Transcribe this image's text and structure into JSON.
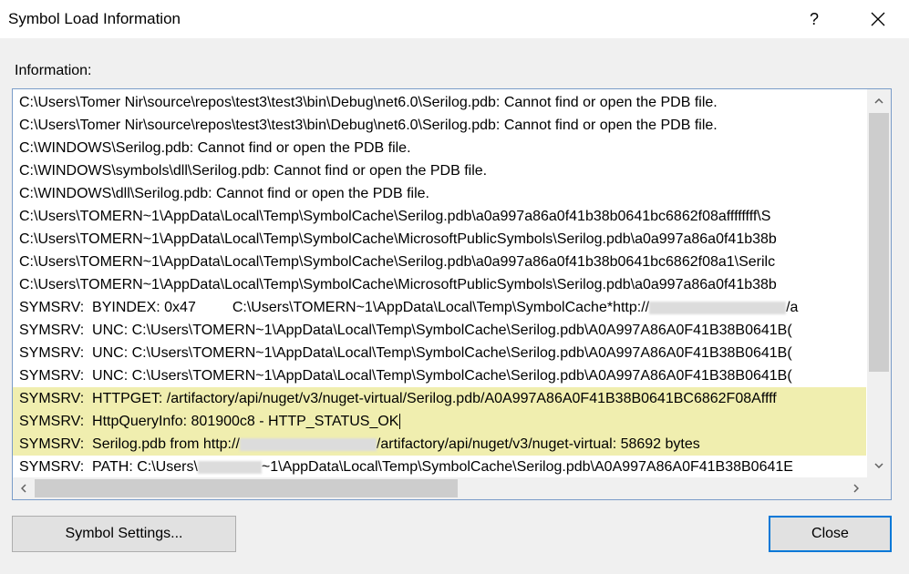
{
  "window": {
    "title": "Symbol Load Information",
    "help_label": "?"
  },
  "info_label": "Information:",
  "lines": [
    "C:\\Users\\Tomer Nir\\source\\repos\\test3\\test3\\bin\\Debug\\net6.0\\Serilog.pdb: Cannot find or open the PDB file.",
    "C:\\Users\\Tomer Nir\\source\\repos\\test3\\test3\\bin\\Debug\\net6.0\\Serilog.pdb: Cannot find or open the PDB file.",
    "C:\\WINDOWS\\Serilog.pdb: Cannot find or open the PDB file.",
    "C:\\WINDOWS\\symbols\\dll\\Serilog.pdb: Cannot find or open the PDB file.",
    "C:\\WINDOWS\\dll\\Serilog.pdb: Cannot find or open the PDB file.",
    "C:\\Users\\TOMERN~1\\AppData\\Local\\Temp\\SymbolCache\\Serilog.pdb\\a0a997a86a0f41b38b0641bc6862f08affffffff\\S",
    "C:\\Users\\TOMERN~1\\AppData\\Local\\Temp\\SymbolCache\\MicrosoftPublicSymbols\\Serilog.pdb\\a0a997a86a0f41b38b",
    "C:\\Users\\TOMERN~1\\AppData\\Local\\Temp\\SymbolCache\\Serilog.pdb\\a0a997a86a0f41b38b0641bc6862f08a1\\Serilc",
    "C:\\Users\\TOMERN~1\\AppData\\Local\\Temp\\SymbolCache\\MicrosoftPublicSymbols\\Serilog.pdb\\a0a997a86a0f41b38b",
    "SYMSRV:  UNC: C:\\Users\\TOMERN~1\\AppData\\Local\\Temp\\SymbolCache\\Serilog.pdb\\A0A997A86A0F41B38B0641B(",
    "SYMSRV:  UNC: C:\\Users\\TOMERN~1\\AppData\\Local\\Temp\\SymbolCache\\Serilog.pdb\\A0A997A86A0F41B38B0641B(",
    "SYMSRV:  UNC: C:\\Users\\TOMERN~1\\AppData\\Local\\Temp\\SymbolCache\\Serilog.pdb\\A0A997A86A0F41B38B0641B(",
    "SYMSRV:  HTTPGET: /artifactory/api/nuget/v3/nuget-virtual/Serilog.pdb/A0A997A86A0F41B38B0641BC6862F08Affff"
  ],
  "symsrv_byindex": {
    "prefix": "SYMSRV:  BYINDEX: 0x47         C:\\Users\\TOMERN~1\\AppData\\Local\\Temp\\SymbolCache*http://",
    "suffix": "/a"
  },
  "symsrv_query": "SYMSRV:  HttpQueryInfo: 801900c8 - HTTP_STATUS_OK",
  "symsrv_from": {
    "prefix": "SYMSRV:  Serilog.pdb from http://",
    "suffix": "/artifactory/api/nuget/v3/nuget-virtual: 58692 bytes"
  },
  "symsrv_path": {
    "prefix": "SYMSRV:  PATH: C:\\Users\\",
    "suffix": "~1\\AppData\\Local\\Temp\\SymbolCache\\Serilog.pdb\\A0A997A86A0F41B38B0641E"
  },
  "buttons": {
    "symbol_settings": "Symbol Settings...",
    "close": "Close"
  }
}
